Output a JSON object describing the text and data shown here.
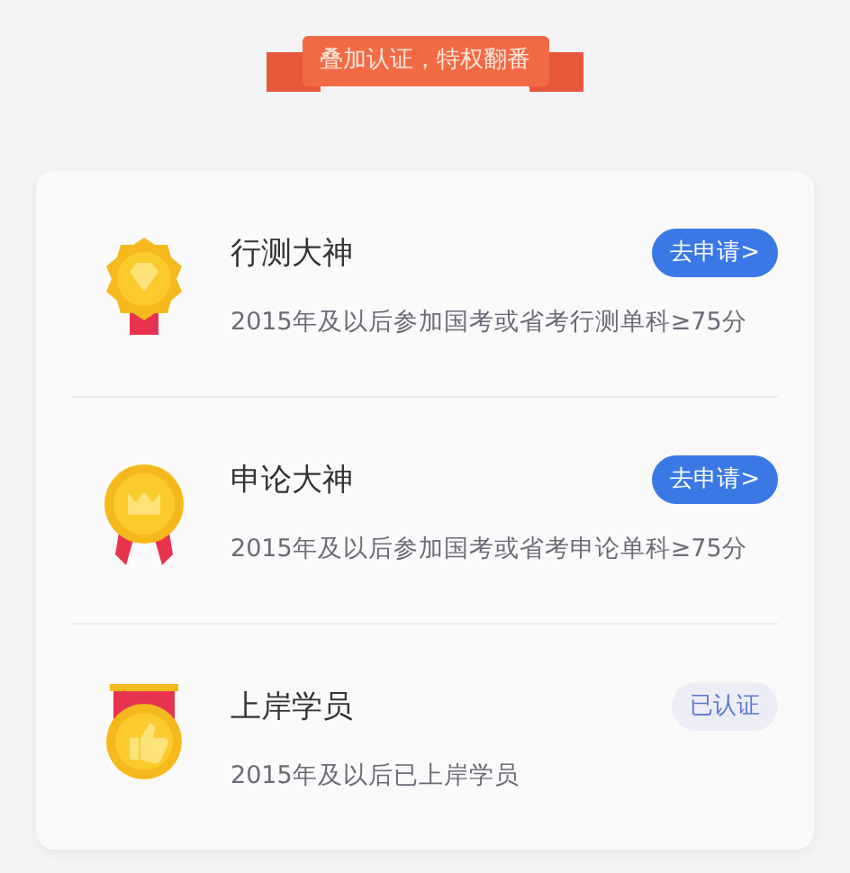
{
  "banner": {
    "text": "叠加认证，特权翻番"
  },
  "certifications": [
    {
      "kind": "diamond",
      "title": "行测大神",
      "description": "2015年及以后参加国考或省考行测单科≥75分",
      "action": "去申请>",
      "verified": false
    },
    {
      "kind": "crown",
      "title": "申论大神",
      "description": "2015年及以后参加国考或省考申论单科≥75分",
      "action": "去申请>",
      "verified": false
    },
    {
      "kind": "thumb",
      "title": "上岸学员",
      "description": "2015年及以后已上岸学员",
      "action": "已认证",
      "verified": true
    }
  ]
}
